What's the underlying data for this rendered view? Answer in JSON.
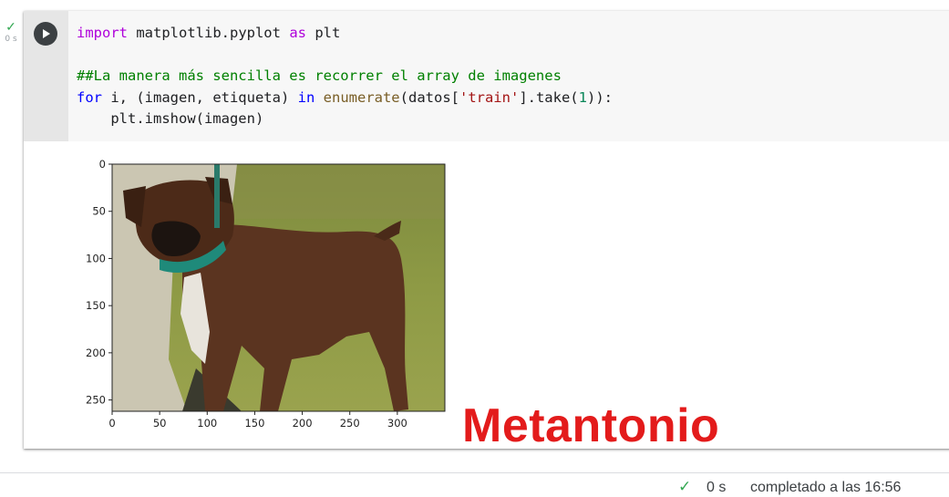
{
  "cell": {
    "exec_time_label": "0 s",
    "code_lines": [
      [
        {
          "t": "import",
          "c": "kw"
        },
        {
          "t": " matplotlib.pyplot ",
          "c": ""
        },
        {
          "t": "as",
          "c": "kw"
        },
        {
          "t": " plt",
          "c": ""
        }
      ],
      [],
      [
        {
          "t": "##La manera más sencilla es recorrer el array de imagenes",
          "c": "cm"
        }
      ],
      [
        {
          "t": "for",
          "c": "kw2"
        },
        {
          "t": " i, (imagen, etiqueta) ",
          "c": ""
        },
        {
          "t": "in",
          "c": "kw2"
        },
        {
          "t": " ",
          "c": ""
        },
        {
          "t": "enumerate",
          "c": "fn"
        },
        {
          "t": "(datos[",
          "c": ""
        },
        {
          "t": "'train'",
          "c": "st"
        },
        {
          "t": "].take(",
          "c": ""
        },
        {
          "t": "1",
          "c": "nm"
        },
        {
          "t": ")):",
          "c": ""
        }
      ],
      [
        {
          "t": "    plt.imshow(imagen)",
          "c": ""
        }
      ]
    ]
  },
  "plot": {
    "image_icon": "dog-photo",
    "xticks": [
      0,
      50,
      100,
      150,
      200,
      250,
      300
    ],
    "yticks": [
      0,
      50,
      100,
      150,
      200,
      250
    ],
    "xlim": [
      0,
      350
    ],
    "ylim": [
      0,
      262
    ]
  },
  "watermark": "Metantonio",
  "status": {
    "time": "0 s",
    "text": "completado a las 16:56"
  },
  "colors": {
    "success": "#34a853",
    "watermark": "#e31b1b"
  }
}
